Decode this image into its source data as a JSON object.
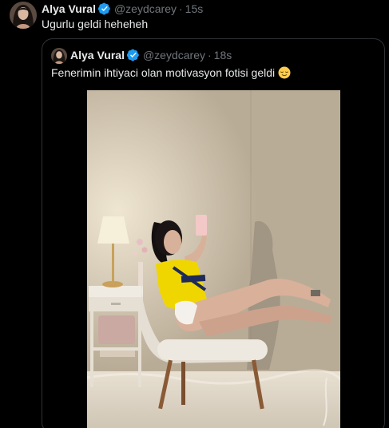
{
  "tweet": {
    "author_name": "Alya Vural",
    "handle": "@zeydcarey",
    "separator": "·",
    "time": "15s",
    "text": "Ugurlu geldi heheheh"
  },
  "quoted_tweet": {
    "author_name": "Alya Vural",
    "handle": "@zeydcarey",
    "separator": "·",
    "time": "18s",
    "text": "Fenerimin ihtiyaci olan motivasyon fotisi geldi",
    "emoji": "relieved-face-emoji"
  },
  "icons": {
    "verified": "verified-badge-icon"
  },
  "colors": {
    "background": "#000000",
    "text_primary": "#e7e9ea",
    "text_secondary": "#71767b",
    "border": "#2f3336",
    "verified_blue": "#1d9bf0"
  }
}
